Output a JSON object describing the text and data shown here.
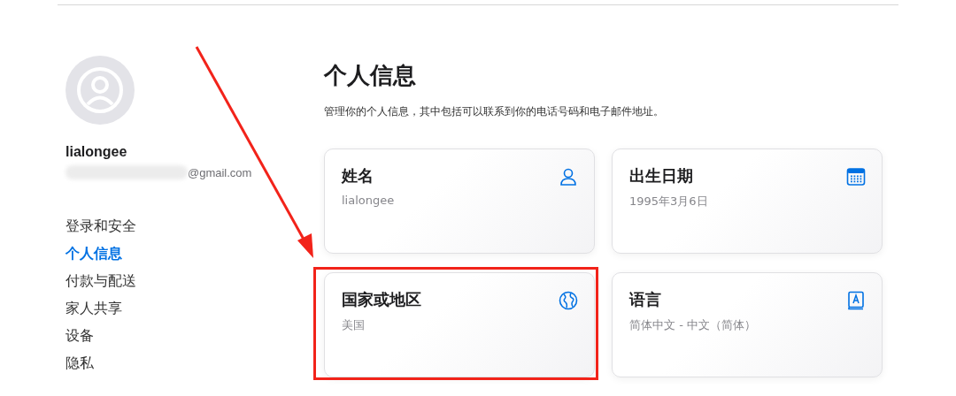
{
  "sidebar": {
    "username": "lialongee",
    "email": "@gmail.com",
    "email_redacted": true,
    "nav": [
      {
        "label": "登录和安全",
        "selected": false
      },
      {
        "label": "个人信息",
        "selected": true
      },
      {
        "label": "付款与配送",
        "selected": false
      },
      {
        "label": "家人共享",
        "selected": false
      },
      {
        "label": "设备",
        "selected": false
      },
      {
        "label": "隐私",
        "selected": false
      }
    ]
  },
  "main": {
    "title": "个人信息",
    "description": "管理你的个人信息，其中包括可以联系到你的电话号码和电子邮件地址。",
    "cards": [
      {
        "kind": "person",
        "title": "姓名",
        "value": "lialongee",
        "highlighted": false
      },
      {
        "kind": "calendar",
        "title": "出生日期",
        "value": "1995年3月6日",
        "highlighted": false
      },
      {
        "kind": "globe",
        "title": "国家或地区",
        "value": "美国",
        "highlighted": true
      },
      {
        "kind": "book",
        "title": "语言",
        "value": "简体中文 - 中文（简体）",
        "highlighted": false
      }
    ]
  },
  "annotation_arrow": true
}
